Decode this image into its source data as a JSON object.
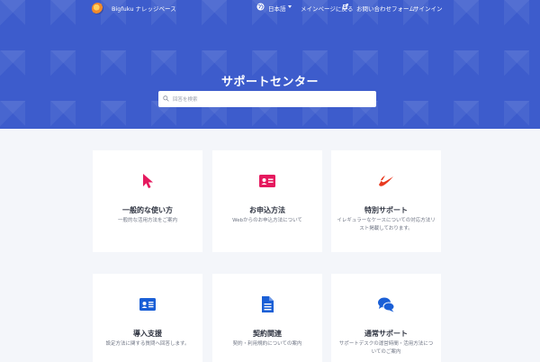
{
  "header": {
    "brand": "Bigfuku ナレッジベース",
    "nav": {
      "language": "日本語",
      "main_page": "メインページに戻る",
      "contact": "お問い合わせフォーム",
      "sign_in": "サインイン"
    }
  },
  "hero": {
    "title": "サポートセンター",
    "search_placeholder": "回答を検索"
  },
  "categories": [
    {
      "title": "一般的な使い方",
      "desc": "一般的な活用方法をご案内",
      "icon": "cursor-icon"
    },
    {
      "title": "お申込方法",
      "desc": "Webからのお申込方法について",
      "icon": "id-card-icon"
    },
    {
      "title": "特別サポート",
      "desc": "イレギュラーなケースについての対応方法リスト掲載しております。",
      "icon": "swoosh-icon"
    },
    {
      "title": "導入支援",
      "desc": "設定方法に関する質問へ回答します。",
      "icon": "profile-card-icon"
    },
    {
      "title": "契約関連",
      "desc": "契約・利用規約についての案内",
      "icon": "document-icon"
    },
    {
      "title": "通常サポート",
      "desc": "サポートデスクの運営時間・活用方法についてのご案内",
      "icon": "chat-bubbles-icon"
    }
  ],
  "colors": {
    "hero_bg": "#3d5ccc",
    "accent_pink": "#e5195e",
    "accent_red": "#e8391f",
    "accent_blue": "#1a5fd6"
  }
}
